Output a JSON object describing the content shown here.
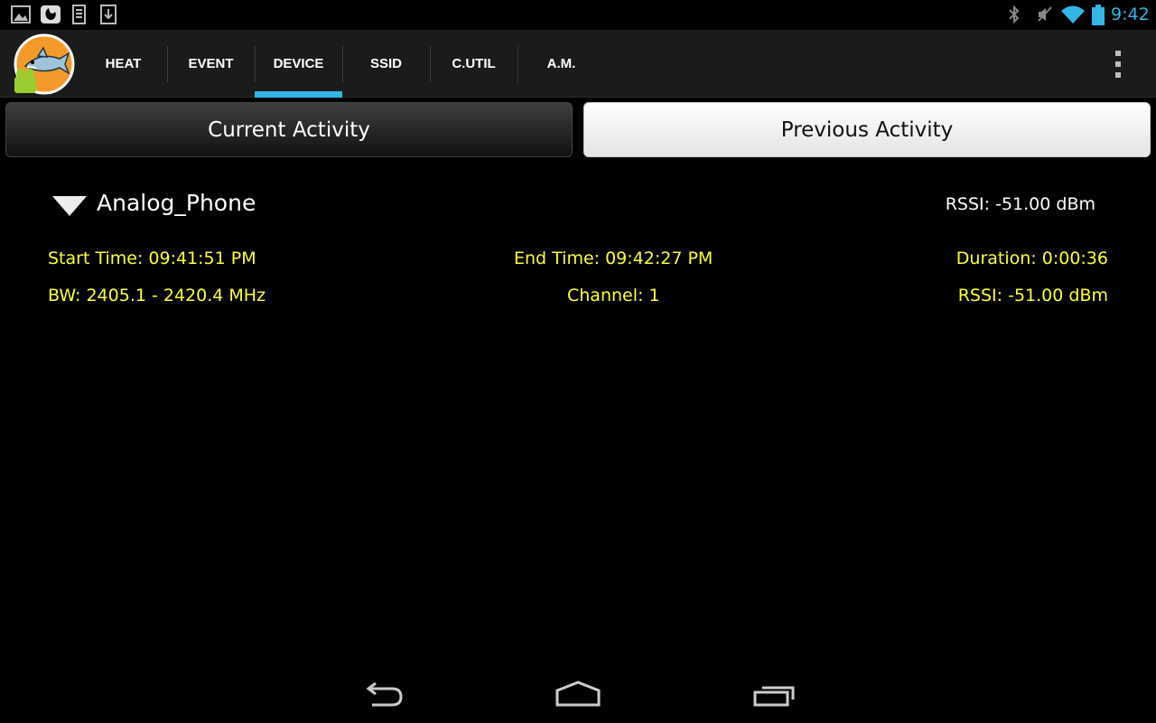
{
  "status_bar": {
    "left_icons": [
      "gallery-icon",
      "app-icon",
      "sim-icon",
      "download-icon"
    ],
    "right_icons": [
      "bluetooth-icon",
      "mute-icon",
      "wifi-icon",
      "battery-icon"
    ],
    "time": "9:42",
    "accent_color": "#33b5e5"
  },
  "action_bar": {
    "tabs": [
      {
        "label": "HEAT",
        "active": false
      },
      {
        "label": "EVENT",
        "active": false
      },
      {
        "label": "DEVICE",
        "active": true
      },
      {
        "label": "SSID",
        "active": false
      },
      {
        "label": "C.UTIL",
        "active": false
      },
      {
        "label": "A.M.",
        "active": false
      }
    ]
  },
  "segments": {
    "current": "Current Activity",
    "previous": "Previous Activity"
  },
  "device": {
    "name": "Analog_Phone",
    "rssi": "RSSI: -51.00 dBm",
    "start_time": "Start Time: 09:41:51 PM",
    "end_time": "End Time: 09:42:27 PM",
    "duration": "Duration: 0:00:36",
    "bw": "BW: 2405.1 - 2420.4 MHz",
    "channel": "Channel: 1",
    "rssi_detail": "RSSI: -51.00 dBm",
    "detail_color": "#ffff33"
  },
  "nav_bar": {
    "buttons": [
      "back-icon",
      "home-icon",
      "recent-apps-icon"
    ]
  }
}
